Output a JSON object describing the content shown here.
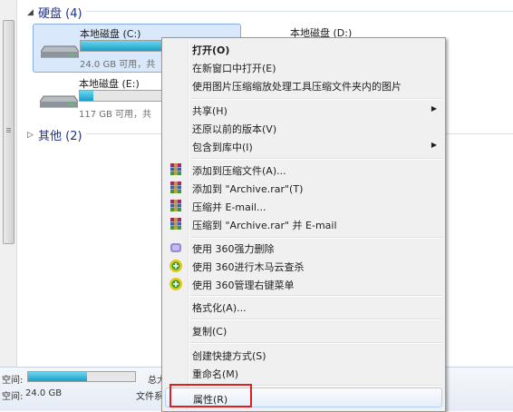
{
  "explorer": {
    "group_hard_disks": "硬盘 (4)",
    "group_other": "其他 (2)",
    "drives": [
      {
        "name": "本地磁盘 (C:)",
        "free_text": "24.0 GB 可用，共",
        "used_fraction": 0.78,
        "selected": true
      },
      {
        "name": "本地磁盘 (D:)"
      },
      {
        "name": "本地磁盘 (E:)",
        "free_text": "117 GB 可用，共",
        "used_fraction": 0.12,
        "selected": false
      }
    ]
  },
  "status_bar": {
    "space_label_1": "空间:",
    "total_label": "总大",
    "space_label_2": "空间:",
    "free_value": "24.0 GB",
    "filesystem_label": "文件系",
    "used_fraction": 0.55
  },
  "context_menu": {
    "items": [
      {
        "label": "打开(O)"
      },
      {
        "label": "在新窗口中打开(E)"
      },
      {
        "label": "使用图片压缩缩放处理工具压缩文件夹内的图片"
      },
      {
        "label": "共享(H)",
        "arrow": "▶"
      },
      {
        "label": "还原以前的版本(V)"
      },
      {
        "label": "包含到库中(I)",
        "arrow": "▶"
      },
      {
        "label": "添加到压缩文件(A)...",
        "icon": "winrar-icon"
      },
      {
        "label": "添加到 \"Archive.rar\"(T)",
        "icon": "winrar-icon"
      },
      {
        "label": "压缩并 E-mail...",
        "icon": "winrar-icon"
      },
      {
        "label": "压缩到 \"Archive.rar\" 并 E-mail",
        "icon": "winrar-icon"
      },
      {
        "label": "使用 360强力删除",
        "icon": "360-delete-icon"
      },
      {
        "label": "使用 360进行木马云查杀",
        "icon": "360-security-icon"
      },
      {
        "label": "使用 360管理右键菜单",
        "icon": "360-security-icon"
      },
      {
        "label": "格式化(A)..."
      },
      {
        "label": "复制(C)"
      },
      {
        "label": "创建快捷方式(S)"
      },
      {
        "label": "重命名(M)"
      },
      {
        "label": "属性(R)"
      }
    ]
  },
  "colors": {
    "highlight": "#e02020",
    "group_header": "#1e3287",
    "selection": "#d9e8fb"
  }
}
